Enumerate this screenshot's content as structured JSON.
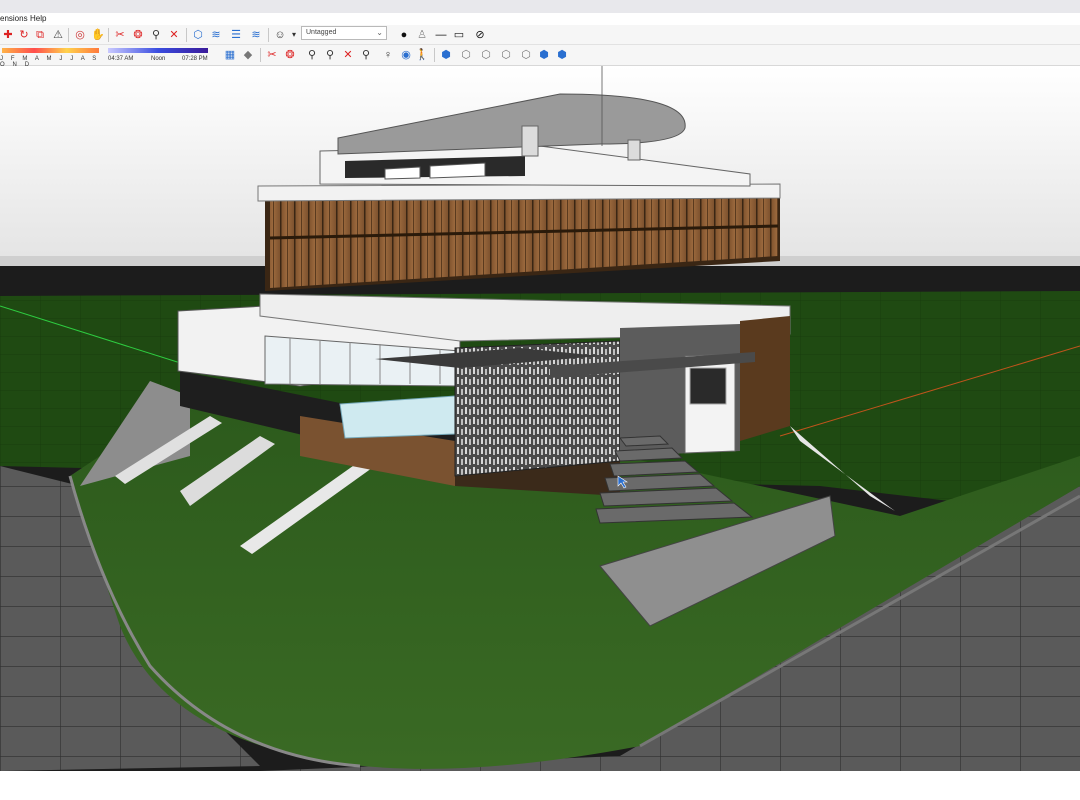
{
  "menu": {
    "extensions": "ensions",
    "help": "Help"
  },
  "tag_select": {
    "value": "Untagged"
  },
  "shadow": {
    "months": "J F M A M J J A S O N D",
    "time_start": "04:37 AM",
    "noon": "Noon",
    "time_end": "07:28 PM"
  },
  "toolbar_row1": [
    "move-icon",
    "rotate-icon",
    "scale-icon",
    "warning-icon",
    "orbit-icon",
    "pan-icon",
    "section-plane-icon",
    "section-cut-icon",
    "zoom-icon",
    "zoom-extents-icon",
    "components-icon",
    "layers-icon",
    "materials-icon",
    "styles-icon",
    "profile-icon"
  ],
  "toolbar_row1_right": [
    "dot-icon",
    "light-icon",
    "line-icon",
    "rectangle-icon",
    "hide-icon"
  ],
  "toolbar_row2": [
    "shadow-settings-icon",
    "shadow-toggle-icon",
    "fog-icon",
    "walk-icon",
    "position-camera-icon",
    "zoom-window-icon",
    "zoom-previous-icon",
    "section-fill-icon",
    "look-around-icon",
    "walk-person-icon",
    "iso-view-icon",
    "top-view-icon",
    "front-view-icon",
    "right-view-icon",
    "back-view-icon",
    "left-view-icon"
  ],
  "colors": {
    "sky_top": "#ffffff",
    "sky_bottom": "#e3e3e3",
    "lawn": "#2f5a1f",
    "wood": "#8a5a32",
    "road": "#5a5a5a",
    "slab": "#e8e8e8"
  }
}
